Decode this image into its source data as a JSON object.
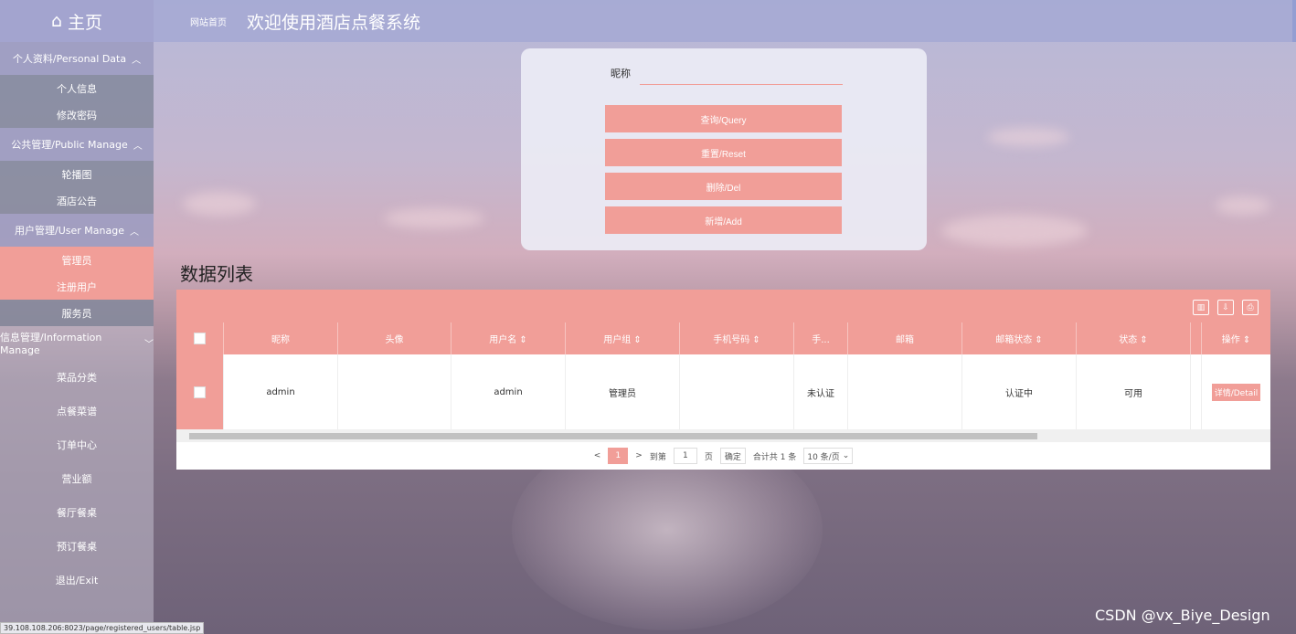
{
  "sidebar": {
    "home": "主页",
    "groups": [
      {
        "label": "个人资料/Personal Data",
        "items": [
          "个人信息",
          "修改密码"
        ]
      },
      {
        "label": "公共管理/Public Manage",
        "items": [
          "轮播图",
          "酒店公告"
        ]
      },
      {
        "label": "用户管理/User Manage",
        "items": [
          "管理员",
          "注册用户",
          "服务员"
        ]
      }
    ],
    "info_group": "信息管理/Information Manage",
    "info_items": [
      "菜品分类",
      "点餐菜谱",
      "订单中心",
      "营业额",
      "餐厅餐桌",
      "预订餐桌",
      "退出/Exit"
    ]
  },
  "topbar": {
    "breadcrumb": "网站首页",
    "title": "欢迎使用酒店点餐系统"
  },
  "search": {
    "nick_label": "昵称",
    "query": "查询/Query",
    "reset": "重置/Reset",
    "delete": "删除/Del",
    "add": "新增/Add"
  },
  "list_title": "数据列表",
  "table": {
    "headers": [
      "昵称",
      "头像",
      "用户名 ⇕",
      "用户组 ⇕",
      "手机号码 ⇕",
      "手...",
      "邮箱",
      "邮箱状态 ⇕",
      "状态 ⇕",
      "操作 ⇕"
    ],
    "rows": [
      {
        "nickname": "admin",
        "avatar": "",
        "username": "admin",
        "group": "管理员",
        "phone": "",
        "phone_status": "未认证",
        "email": "",
        "email_status": "认证中",
        "status": "可用",
        "action": "详情/Detail"
      }
    ]
  },
  "pager": {
    "prev": "<",
    "current": "1",
    "next": ">",
    "goto": "到第",
    "page_value": "1",
    "page_unit": "页",
    "confirm": "确定",
    "total": "合计共 1 条",
    "per_page": "10 条/页"
  },
  "status_url": "39.108.108.206:8023/page/registered_users/table.jsp",
  "watermark": "CSDN @vx_Biye_Design",
  "colors": {
    "accent": "#f19e98",
    "topbar": "#a5a8d4"
  }
}
